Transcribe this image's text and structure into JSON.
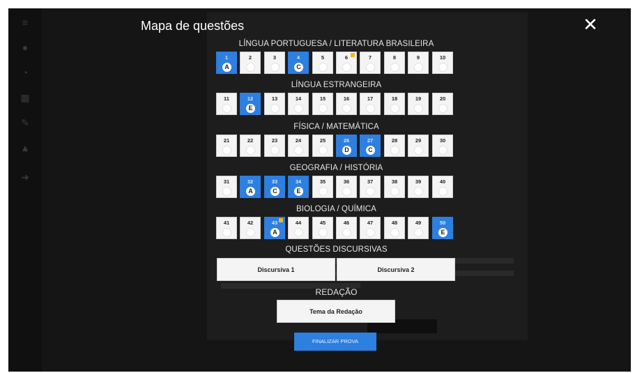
{
  "modal": {
    "title": "Mapa de questões",
    "close_label": "✕"
  },
  "sections": [
    {
      "title": "LÍNGUA PORTUGUESA / LITERATURA BRASILEIRA",
      "questions": [
        {
          "num": "1",
          "answer": "A",
          "flag": false
        },
        {
          "num": "2",
          "answer": "",
          "flag": false
        },
        {
          "num": "3",
          "answer": "",
          "flag": false
        },
        {
          "num": "4",
          "answer": "C",
          "flag": false
        },
        {
          "num": "5",
          "answer": "",
          "flag": false
        },
        {
          "num": "6",
          "answer": "",
          "flag": true
        },
        {
          "num": "7",
          "answer": "",
          "flag": false
        },
        {
          "num": "8",
          "answer": "",
          "flag": false
        },
        {
          "num": "9",
          "answer": "",
          "flag": false
        },
        {
          "num": "10",
          "answer": "",
          "flag": false
        }
      ]
    },
    {
      "title": "LÍNGUA ESTRANGEIRA",
      "questions": [
        {
          "num": "11",
          "answer": "",
          "flag": false
        },
        {
          "num": "12",
          "answer": "E",
          "flag": false
        },
        {
          "num": "13",
          "answer": "",
          "flag": false
        },
        {
          "num": "14",
          "answer": "",
          "flag": false
        },
        {
          "num": "15",
          "answer": "",
          "flag": false
        },
        {
          "num": "16",
          "answer": "",
          "flag": false
        },
        {
          "num": "17",
          "answer": "",
          "flag": false
        },
        {
          "num": "18",
          "answer": "",
          "flag": false
        },
        {
          "num": "19",
          "answer": "",
          "flag": false
        },
        {
          "num": "20",
          "answer": "",
          "flag": false
        }
      ]
    },
    {
      "title": "FÍSICA / MATEMÁTICA",
      "questions": [
        {
          "num": "21",
          "answer": "",
          "flag": false
        },
        {
          "num": "22",
          "answer": "",
          "flag": false
        },
        {
          "num": "23",
          "answer": "",
          "flag": false
        },
        {
          "num": "24",
          "answer": "",
          "flag": false
        },
        {
          "num": "25",
          "answer": "",
          "flag": false
        },
        {
          "num": "26",
          "answer": "D",
          "flag": false
        },
        {
          "num": "27",
          "answer": "C",
          "flag": false
        },
        {
          "num": "28",
          "answer": "",
          "flag": false
        },
        {
          "num": "29",
          "answer": "",
          "flag": false
        },
        {
          "num": "30",
          "answer": "",
          "flag": false
        }
      ]
    },
    {
      "title": "GEOGRAFIA / HISTÓRIA",
      "questions": [
        {
          "num": "31",
          "answer": "",
          "flag": false
        },
        {
          "num": "32",
          "answer": "A",
          "flag": false
        },
        {
          "num": "33",
          "answer": "C",
          "flag": false
        },
        {
          "num": "34",
          "answer": "E",
          "flag": false
        },
        {
          "num": "35",
          "answer": "",
          "flag": false
        },
        {
          "num": "36",
          "answer": "",
          "flag": false
        },
        {
          "num": "37",
          "answer": "",
          "flag": false
        },
        {
          "num": "38",
          "answer": "",
          "flag": false
        },
        {
          "num": "39",
          "answer": "",
          "flag": false
        },
        {
          "num": "40",
          "answer": "",
          "flag": false
        }
      ]
    },
    {
      "title": "BIOLOGIA / QUÍMICA",
      "questions": [
        {
          "num": "41",
          "answer": "",
          "flag": false
        },
        {
          "num": "42",
          "answer": "",
          "flag": false
        },
        {
          "num": "43",
          "answer": "A",
          "flag": true
        },
        {
          "num": "44",
          "answer": "",
          "flag": false
        },
        {
          "num": "45",
          "answer": "",
          "flag": false
        },
        {
          "num": "46",
          "answer": "",
          "flag": false
        },
        {
          "num": "47",
          "answer": "",
          "flag": false
        },
        {
          "num": "48",
          "answer": "",
          "flag": false
        },
        {
          "num": "49",
          "answer": "",
          "flag": false
        },
        {
          "num": "50",
          "answer": "E",
          "flag": false
        }
      ]
    }
  ],
  "discursive": {
    "title": "QUESTÕES DISCURSIVAS",
    "items": [
      "Discursiva 1",
      "Discursiva 2"
    ]
  },
  "essay": {
    "title": "REDAÇÃO",
    "button_label": "Tema da Redação"
  },
  "finish_button": "FINALIZAR PROVA",
  "colors": {
    "answered": "#2d7fe0",
    "flag": "#f0b429",
    "overlay": "#151515"
  }
}
